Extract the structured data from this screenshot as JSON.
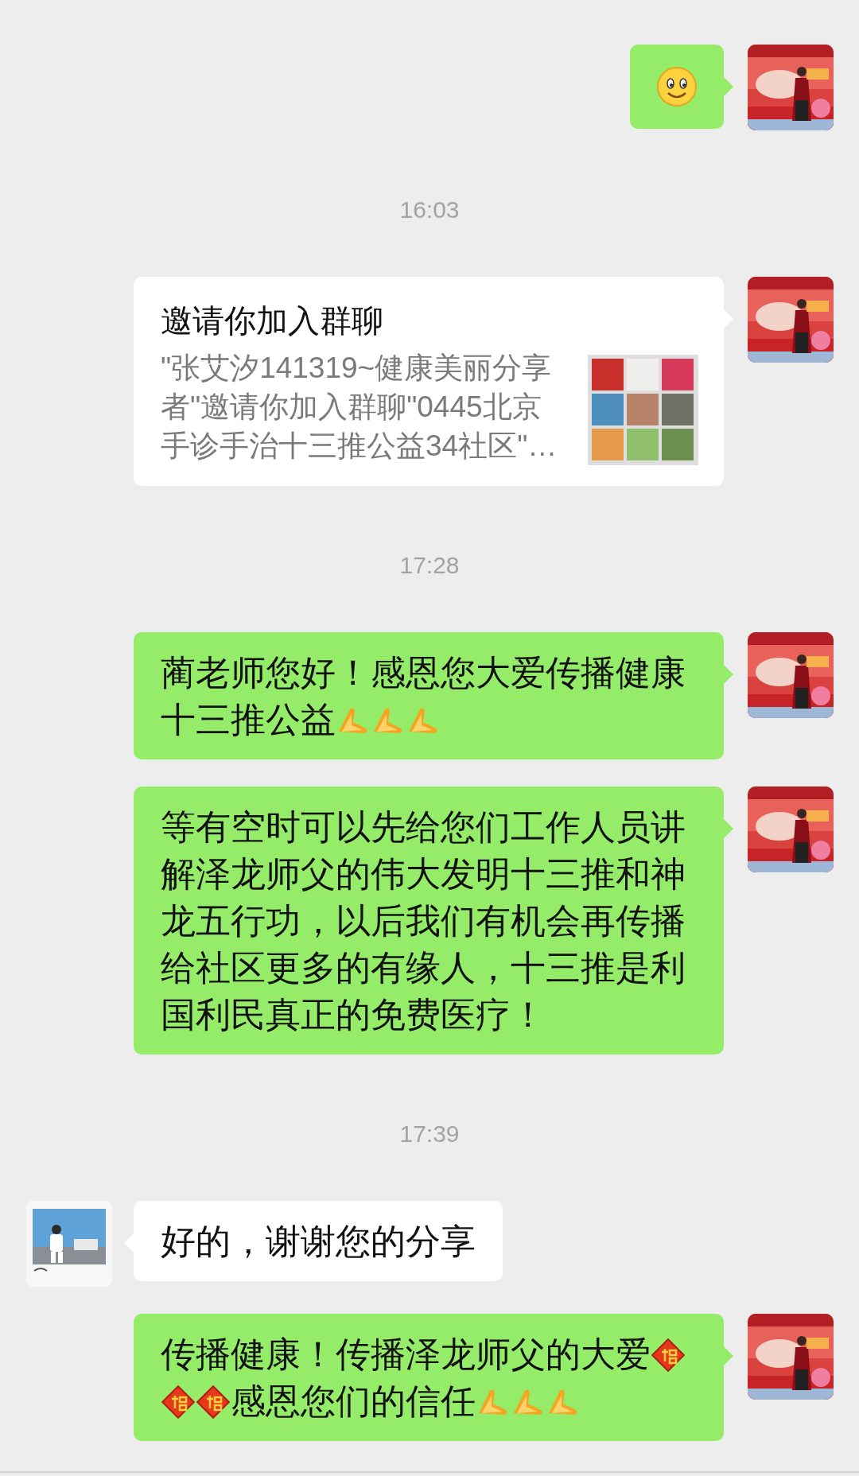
{
  "messages": [
    {
      "kind": "sticker",
      "outgoing": true
    },
    {
      "kind": "time",
      "text": "16:03"
    },
    {
      "kind": "invite",
      "outgoing": true,
      "title": "邀请你加入群聊",
      "description": "\"张艾汐141319~健康美丽分享者\"邀请你加入群聊\"0445北京手诊手治十三推公益34社区\"…"
    },
    {
      "kind": "time",
      "text": "17:28"
    },
    {
      "kind": "text",
      "outgoing": true,
      "parts": [
        {
          "kind": "text",
          "text": "蔺老师您好！感恩您大爱传播健康十三推公益"
        },
        {
          "kind": "hands"
        },
        {
          "kind": "hands"
        },
        {
          "kind": "hands"
        }
      ]
    },
    {
      "kind": "text",
      "outgoing": true,
      "parts": [
        {
          "kind": "text",
          "text": "等有空时可以先给您们工作人员讲解泽龙师父的伟大发明十三推和神龙五行功，以后我们有机会再传播给社区更多的有缘人，十三推是利国利民真正的免费医疗！"
        }
      ]
    },
    {
      "kind": "time",
      "text": "17:39"
    },
    {
      "kind": "text",
      "outgoing": false,
      "parts": [
        {
          "kind": "text",
          "text": "好的，谢谢您的分享"
        }
      ]
    },
    {
      "kind": "text",
      "outgoing": true,
      "parts": [
        {
          "kind": "text",
          "text": "传播健康！传播泽龙师父的大爱"
        },
        {
          "kind": "fu"
        },
        {
          "kind": "fu"
        },
        {
          "kind": "fu"
        },
        {
          "kind": "text",
          "text": "感恩您们的信任"
        },
        {
          "kind": "hands"
        },
        {
          "kind": "hands"
        },
        {
          "kind": "hands"
        }
      ]
    }
  ]
}
